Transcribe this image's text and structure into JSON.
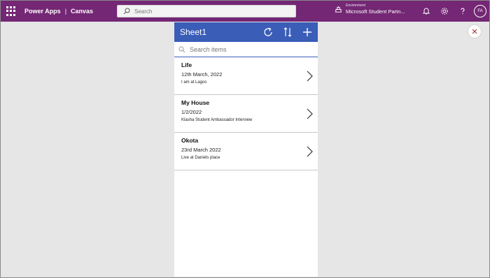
{
  "topbar": {
    "app_name": "Power Apps",
    "separator": "|",
    "mode": "Canvas",
    "search_placeholder": "Search",
    "environment_label": "Environment",
    "environment_name": "Microsoft Student Partn...",
    "avatar_initials": "FA",
    "bg_color": "#742774"
  },
  "app": {
    "title": "Sheet1",
    "header_color": "#3a5db8",
    "search_placeholder": "Search items",
    "items": [
      {
        "title": "Life",
        "subtitle": "12th March, 2022",
        "body": "I am at Lagos"
      },
      {
        "title": "My House",
        "subtitle": "1/2/2022",
        "body": "Klasha Student Ambassador Interview"
      },
      {
        "title": "Okota",
        "subtitle": "23rd March 2022",
        "body": "Live at Daniels place"
      }
    ]
  }
}
